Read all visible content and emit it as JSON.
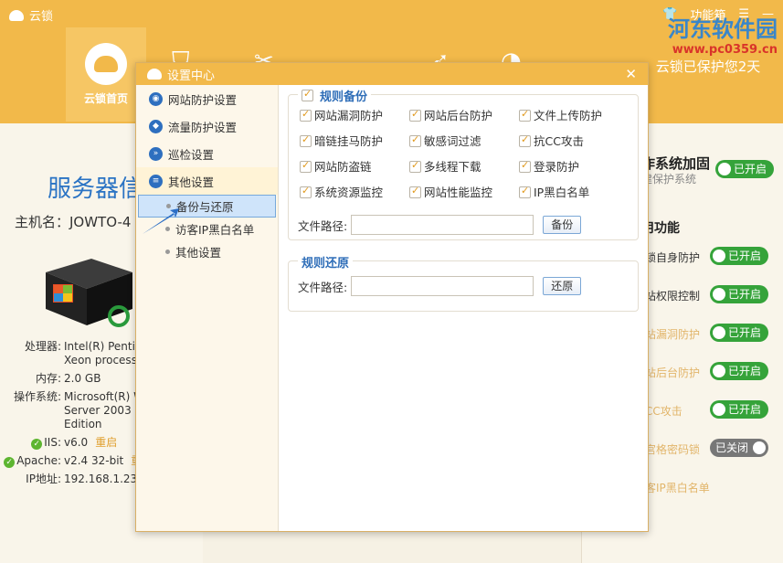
{
  "app": {
    "title": "云锁",
    "feature_box": "功能箱",
    "nav_home": "云锁首页",
    "protect_text": "云锁已保护您2天"
  },
  "watermark": {
    "title": "河东软件园",
    "url": "www.pc0359.cn"
  },
  "server": {
    "title": "服务器信",
    "host": "主机名：JOWTO-4",
    "info": [
      {
        "k": "处理器:",
        "v": "Intel(R) Pentiu",
        "v2": "Xeon process"
      },
      {
        "k": "内存:",
        "v": "2.0 GB"
      },
      {
        "k": "操作系统:",
        "v": "Microsoft(R) W",
        "v2": "Server 2003 S",
        "v3": "Edition"
      },
      {
        "k": "IIS:",
        "v": "v6.0",
        "action": "重启"
      },
      {
        "k": "Apache:",
        "v": "v2.4 32-bit",
        "action": "重"
      },
      {
        "k": "IP地址:",
        "v": "192.168.1.232"
      }
    ]
  },
  "right_panel": {
    "heading": "作系统加固",
    "sub": "建保护系统",
    "section": "用功能",
    "toggle_on": "已开启",
    "toggle_off": "已关闭",
    "items": [
      "锁自身防护",
      "站权限控制",
      "站漏洞防护",
      "站后台防护",
      "CC攻击",
      "宫格密码锁",
      "客IP黑白名单"
    ]
  },
  "dialog": {
    "title": "设置中心",
    "menu": {
      "site": "网站防护设置",
      "traffic": "流量防护设置",
      "patrol": "巡检设置",
      "other": "其他设置",
      "sub": [
        "备份与还原",
        "访客IP黑白名单",
        "其他设置"
      ]
    },
    "backup": {
      "legend": "规则备份",
      "options": [
        "网站漏洞防护",
        "网站后台防护",
        "文件上传防护",
        "暗链挂马防护",
        "敏感词过滤",
        "抗CC攻击",
        "网站防盗链",
        "多线程下载",
        "登录防护",
        "系统资源监控",
        "网站性能监控",
        "IP黑白名单"
      ],
      "path_label": "文件路径:",
      "button": "备份"
    },
    "restore": {
      "legend": "规则还原",
      "path_label": "文件路径:",
      "button": "还原"
    }
  }
}
